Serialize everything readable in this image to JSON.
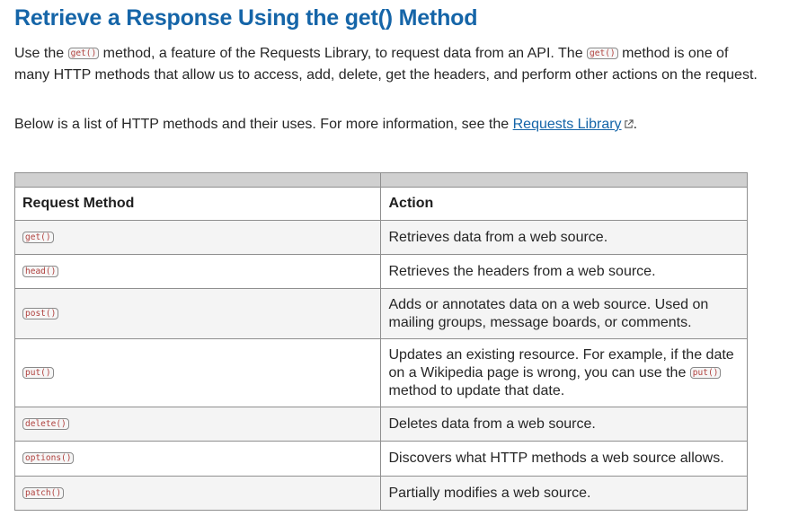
{
  "title": "Retrieve a Response Using the get() Method",
  "intro": {
    "part1": "Use the ",
    "code1": "get()",
    "part2": " method, a feature of the Requests Library, to request data from an API. The ",
    "code2": "get()",
    "part3": " method is one of many HTTP methods that allow us to access, add, delete, get the headers, and perform other actions on the request."
  },
  "below": {
    "text": "Below is a list of HTTP methods and their uses. For more information, see the ",
    "link_label": "Requests Library",
    "after": "."
  },
  "table": {
    "headers": [
      "Request Method",
      "Action"
    ],
    "rows": [
      {
        "method": "get()",
        "action": "Retrieves data from a web source."
      },
      {
        "method": "head()",
        "action": "Retrieves the headers from a web source."
      },
      {
        "method": "post()",
        "action": "Adds or annotates data on a web source. Used on mailing groups, message boards, or comments."
      },
      {
        "method": "put()",
        "action_pre": "Updates an existing resource. For example, if the date on a Wikipedia page is wrong, you can use the ",
        "action_code": "put()",
        "action_post": " method to update that date."
      },
      {
        "method": "delete()",
        "action": "Deletes data from a web source."
      },
      {
        "method": "options()",
        "action": "Discovers what HTTP methods a web source allows."
      },
      {
        "method": "patch()",
        "action": "Partially modifies a web source."
      }
    ]
  },
  "icons": {
    "external_link": "external-link-icon"
  },
  "colors": {
    "heading": "#1565a8",
    "link": "#1565a8",
    "code_text": "#b0413e",
    "table_top_band": "#d0d0d0",
    "row_alt": "#f4f4f4"
  }
}
